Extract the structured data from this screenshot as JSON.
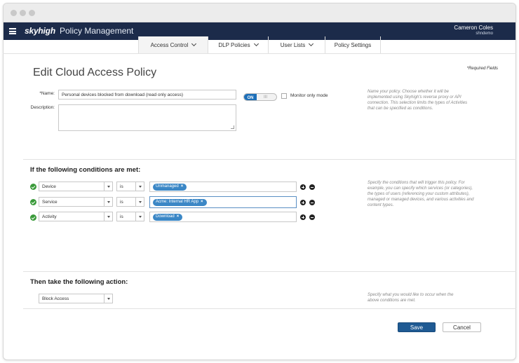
{
  "window": {
    "title": ""
  },
  "app": {
    "logo": "skyhigh",
    "name": "Policy Management",
    "user": {
      "name": "Cameron Coles",
      "tenant": "shndemo"
    }
  },
  "tabs": [
    {
      "label": "Access Control",
      "dropdown": true,
      "active": true
    },
    {
      "label": "DLP Policies",
      "dropdown": true,
      "active": false
    },
    {
      "label": "User Lists",
      "dropdown": true,
      "active": false
    },
    {
      "label": "Policy Settings",
      "dropdown": false,
      "active": false
    }
  ],
  "page": {
    "title": "Edit Cloud Access Policy",
    "required_note": "*Required Fields"
  },
  "form": {
    "name_label": "*Name:",
    "name_value": "Personal devices blocked from download (read only access)",
    "description_label": "Description:",
    "description_value": "",
    "toggle_on": "ON",
    "toggle_grip": "III",
    "monitor_label": "Monitor only mode",
    "help_name": "Name your policy. Choose whether it will be implemented using Skyhigh's reverse proxy or API connection. This selection limits the types of Activities that can be specified as conditions."
  },
  "conditions": {
    "heading": "If the following conditions are met:",
    "help": "Specify the conditions that will trigger this policy. For example, you can specify which services (or categories), the types of users (referencing your custom attributes), managed or managed devices, and various activities and content types.",
    "rows": [
      {
        "field": "Device",
        "operator": "is",
        "tag": "Unmanaged"
      },
      {
        "field": "Service",
        "operator": "is",
        "tag": "Acme: Internal HR App"
      },
      {
        "field": "Activity",
        "operator": "is",
        "tag": "Download"
      }
    ]
  },
  "action": {
    "heading": "Then take the following action:",
    "value": "Block Access",
    "help": "Specify what you would like to occur when the above conditions are met."
  },
  "buttons": {
    "save": "Save",
    "cancel": "Cancel"
  },
  "colors": {
    "header": "#1c2b4a",
    "primary": "#1f5a93",
    "tag": "#3b87c6",
    "success": "#3a9a3a",
    "toggle_on": "#1d6fb8"
  }
}
